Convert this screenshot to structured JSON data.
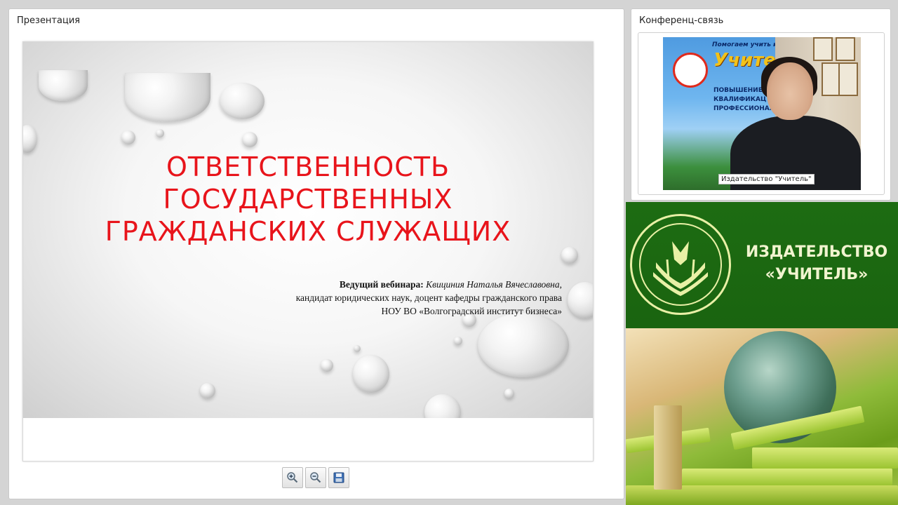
{
  "presentation": {
    "panel_title": "Презентация",
    "slide": {
      "title_lines": [
        "Ответственность",
        "государственных",
        "гражданских служащих"
      ],
      "presenter_label": "Ведущий вебинара:",
      "presenter_name": "Квициния Наталья Вячеславовна",
      "presenter_name_suffix": ",",
      "presenter_line2": "кандидат юридических наук, доцент кафедры гражданского права",
      "presenter_line3": "НОУ ВО «Волгоградский институт бизнеса»"
    },
    "toolbar": {
      "zoom_in_icon": "zoom-in-icon",
      "zoom_out_icon": "zoom-out-icon",
      "save_icon": "floppy-disk-icon"
    }
  },
  "conference": {
    "panel_title": "Конференц-связь",
    "video": {
      "banner_tagline": "Помогаем учить и учиться",
      "banner_brand": "Учител",
      "banner_item1": "ПОВЫШЕНИЕ",
      "banner_item2": "КВАЛИФИКАЦ",
      "banner_item3": "ПРОФЕССИОНАЛ",
      "caption": "Издательство \"Учитель\""
    }
  },
  "ad": {
    "name_line1": "ИЗДАТЕЛЬСТВО",
    "name_line2": "«УЧИТЕЛЬ»"
  },
  "colors": {
    "slide_title": "#e8141b",
    "ad_green": "#1d6c12",
    "ad_text": "#f1f4cf"
  }
}
